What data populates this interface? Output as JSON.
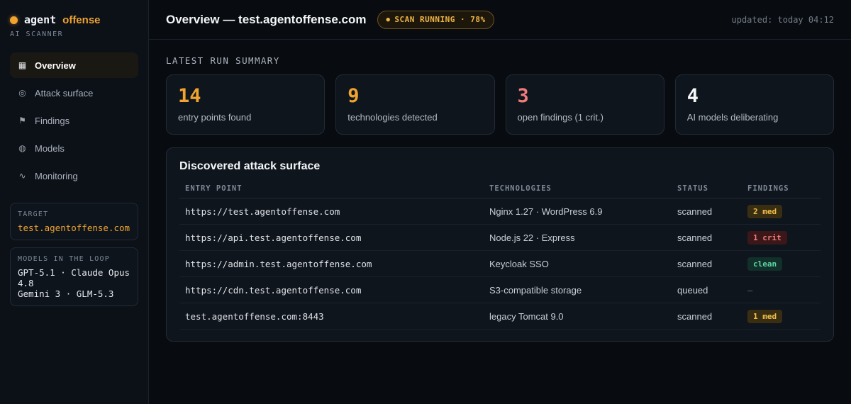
{
  "brand": {
    "name_a": "agent",
    "name_b": "offense",
    "subtitle": "AI SCANNER"
  },
  "nav": [
    {
      "label": "Overview",
      "icon": "grid-icon",
      "glyph": "▦",
      "active": true
    },
    {
      "label": "Attack surface",
      "icon": "target-icon",
      "glyph": "◎",
      "active": false
    },
    {
      "label": "Findings",
      "icon": "flag-icon",
      "glyph": "⚑",
      "active": false
    },
    {
      "label": "Models",
      "icon": "globe-icon",
      "glyph": "◍",
      "active": false
    },
    {
      "label": "Monitoring",
      "icon": "pulse-icon",
      "glyph": "∿",
      "active": false
    }
  ],
  "target": {
    "label": "TARGET",
    "value": "test.agentoffense.com"
  },
  "models_panel": {
    "label": "MODELS IN THE LOOP",
    "line1": "GPT-5.1 · Claude Opus 4.8",
    "line2": "Gemini 3 · GLM-5.3"
  },
  "header": {
    "title": "Overview — test.agentoffense.com",
    "scan_badge": "SCAN RUNNING · 78%",
    "scan_progress": 78,
    "updated": "updated: today 04:12"
  },
  "summary": {
    "label": "LATEST RUN SUMMARY",
    "cards": [
      {
        "value": "14",
        "label": "entry points found",
        "color": "#f0a330"
      },
      {
        "value": "9",
        "label": "technologies detected",
        "color": "#f0a330"
      },
      {
        "value": "3",
        "label": "open findings (1 crit.)",
        "color": "#f07b7b"
      },
      {
        "value": "4",
        "label": "AI models deliberating",
        "color": "#f4f6f8"
      }
    ]
  },
  "surface": {
    "title": "Discovered attack surface",
    "columns": [
      "ENTRY POINT",
      "TECHNOLOGIES",
      "STATUS",
      "FINDINGS"
    ],
    "rows": [
      {
        "entry": "https://test.agentoffense.com",
        "tech": "Nginx 1.27 · WordPress 6.9",
        "status": "scanned",
        "finding": "2 med",
        "severity": "med"
      },
      {
        "entry": "https://api.test.agentoffense.com",
        "tech": "Node.js 22 · Express",
        "status": "scanned",
        "finding": "1 crit",
        "severity": "crit"
      },
      {
        "entry": "https://admin.test.agentoffense.com",
        "tech": "Keycloak SSO",
        "status": "scanned",
        "finding": "clean",
        "severity": "clean"
      },
      {
        "entry": "https://cdn.test.agentoffense.com",
        "tech": "S3-compatible storage",
        "status": "queued",
        "finding": "–",
        "severity": "none"
      },
      {
        "entry": "test.agentoffense.com:8443",
        "tech": "legacy Tomcat 9.0",
        "status": "scanned",
        "finding": "1 med",
        "severity": "med"
      }
    ]
  },
  "colors": {
    "accent": "#f0a330",
    "critical": "#f07b7b",
    "clean": "#5ed6a6",
    "background": "#080b10"
  }
}
